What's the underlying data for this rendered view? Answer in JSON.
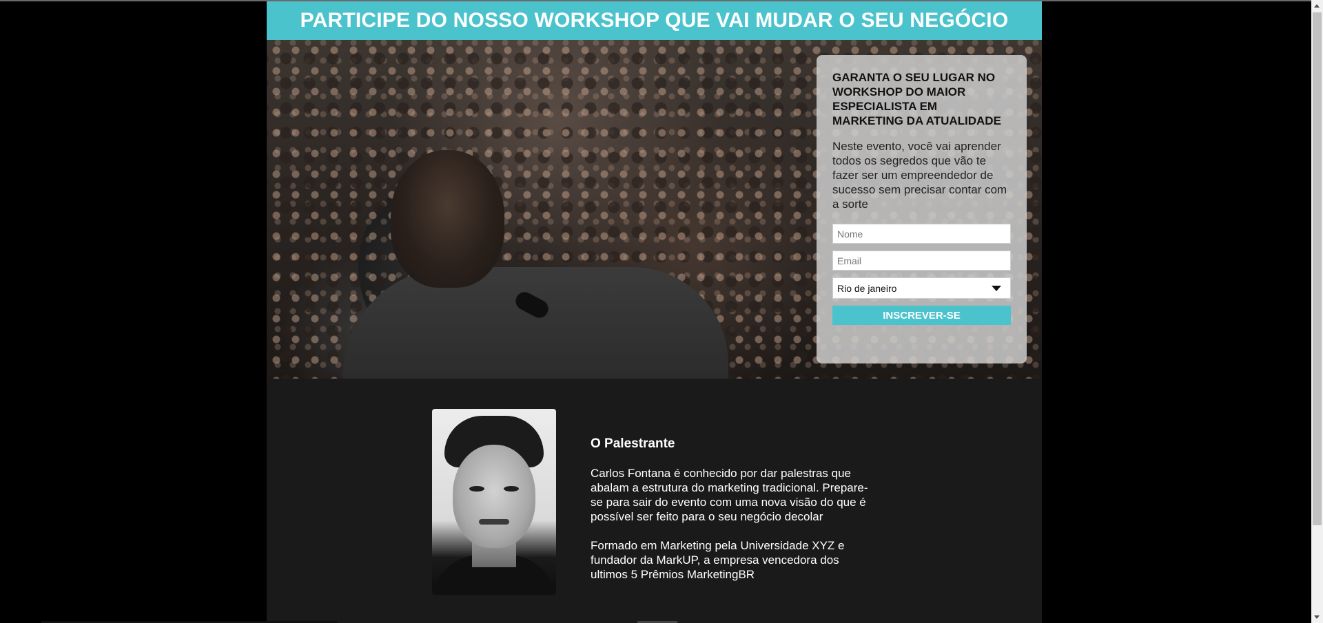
{
  "banner": {
    "title": "PARTICIPE DO NOSSO WORKSHOP QUE VAI MUDAR O SEU NEGÓCIO"
  },
  "form": {
    "title": "GARANTA O SEU LUGAR NO WORKSHOP DO MAIOR ESPECIALISTA EM MARKETING DA ATUALIDADE",
    "description": "Neste evento, você vai aprender todos os segredos que vão te fazer ser um empreendedor de sucesso sem precisar contar com a sorte",
    "name_placeholder": "Nome",
    "email_placeholder": "Email",
    "city_selected": "Rio de janeiro",
    "submit_label": "INSCREVER-SE"
  },
  "speaker": {
    "heading": "O Palestrante",
    "paragraph1": "Carlos Fontana é conhecido por dar palestras que abalam a estrutura do marketing tradicional. Prepare-se para sair do evento com uma nova visão do que é possível ser feito para o seu negócio decolar",
    "paragraph2": "Formado em Marketing pela Universidade XYZ e fundador da MarkUP, a empresa vencedora dos ultimos 5 Prêmios MarketingBR"
  },
  "colors": {
    "accent": "#4bc3cd",
    "page_background": "#1a1a1a",
    "outer_background": "#000000"
  }
}
